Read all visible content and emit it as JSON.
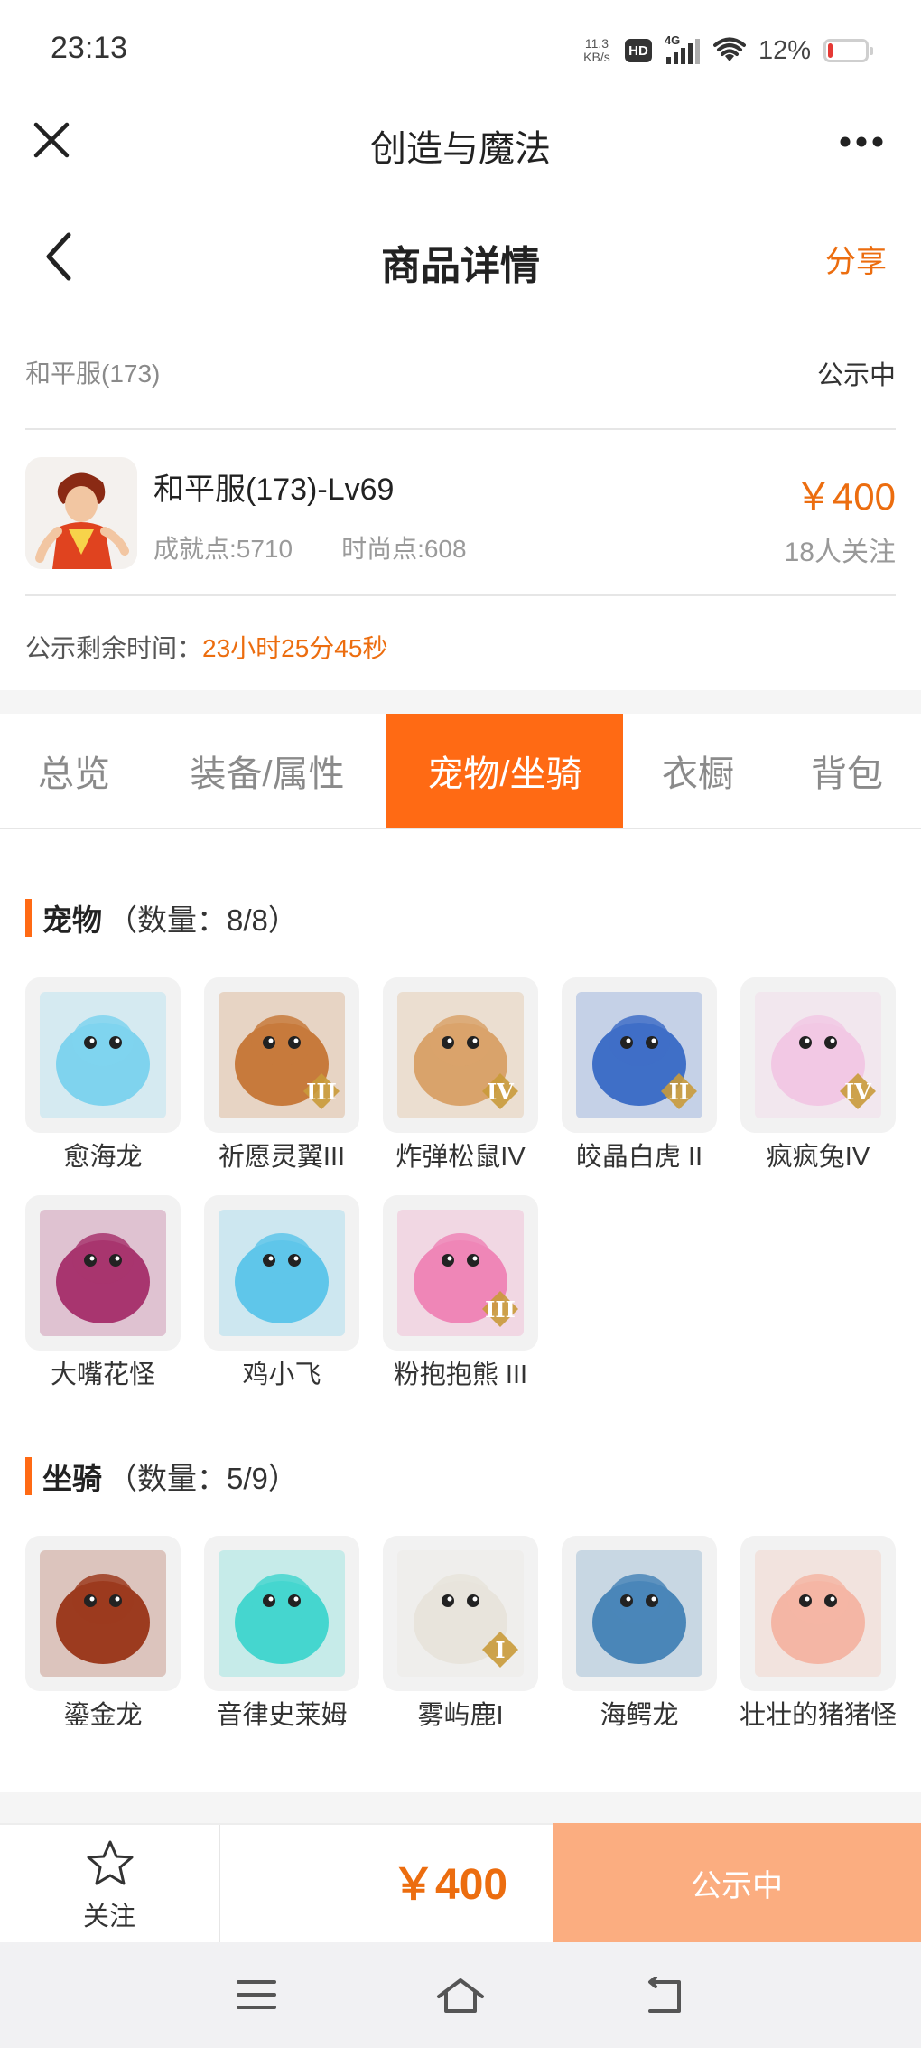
{
  "status_bar": {
    "time": "23:13",
    "net_speed_value": "11.3",
    "net_speed_unit": "KB/s",
    "hd": "HD",
    "network": "4G",
    "battery_percent": "12%",
    "battery_level": 0.12,
    "battery_color": "#e53935"
  },
  "app_bar": {
    "title": "创造与魔法",
    "close_icon": "close-icon",
    "more_icon": "more-icon"
  },
  "page_header": {
    "title": "商品详情",
    "share": "分享"
  },
  "server": {
    "name": "和平服(173)",
    "status": "公示中"
  },
  "product": {
    "name": "和平服(173)-Lv69",
    "achievement": "成就点:5710",
    "fashion": "时尚点:608",
    "price": "￥400",
    "followers": "18人关注"
  },
  "countdown": {
    "label": "公示剩余时间：",
    "value": "23小时25分45秒"
  },
  "tabs": [
    {
      "label": "总览",
      "active": false
    },
    {
      "label": "装备/属性",
      "active": false
    },
    {
      "label": "宠物/坐骑",
      "active": true
    },
    {
      "label": "衣橱",
      "active": false
    },
    {
      "label": "背包",
      "active": false
    }
  ],
  "pets": {
    "title": "宠物",
    "count": "（数量：8/8）",
    "items": [
      {
        "name": "愈海龙",
        "color": "#7fd3ee"
      },
      {
        "name": "祈愿灵翼III",
        "color": "#c77a3c",
        "tier": "III"
      },
      {
        "name": "炸弹松鼠IV",
        "color": "#d9a36b",
        "tier": "IV"
      },
      {
        "name": "皎晶白虎 II",
        "color": "#3f6fc7",
        "tier": "II"
      },
      {
        "name": "疯疯兔IV",
        "color": "#f2c8e4",
        "tier": "IV"
      },
      {
        "name": "大嘴花怪",
        "color": "#a8356f"
      },
      {
        "name": "鸡小飞",
        "color": "#5fc6ea"
      },
      {
        "name": "粉抱抱熊 III",
        "color": "#ef86b7",
        "tier": "III"
      }
    ]
  },
  "mounts": {
    "title": "坐骑",
    "count": "（数量：5/9）",
    "items": [
      {
        "name": "鎏金龙",
        "color": "#9c3b1f"
      },
      {
        "name": "音律史莱姆",
        "color": "#45d6cf"
      },
      {
        "name": "雾屿鹿I",
        "color": "#e8e4dc",
        "tier": "I"
      },
      {
        "name": "海鳄龙",
        "color": "#4a86b8"
      },
      {
        "name": "壮壮的猪猪怪",
        "color": "#f4b6a5"
      }
    ]
  },
  "bottom_bar": {
    "follow": "关注",
    "price": "￥400",
    "action": "公示中"
  },
  "colors": {
    "accent": "#ff6a14",
    "price": "#ec6d0f",
    "action_bg": "#fbad80"
  }
}
